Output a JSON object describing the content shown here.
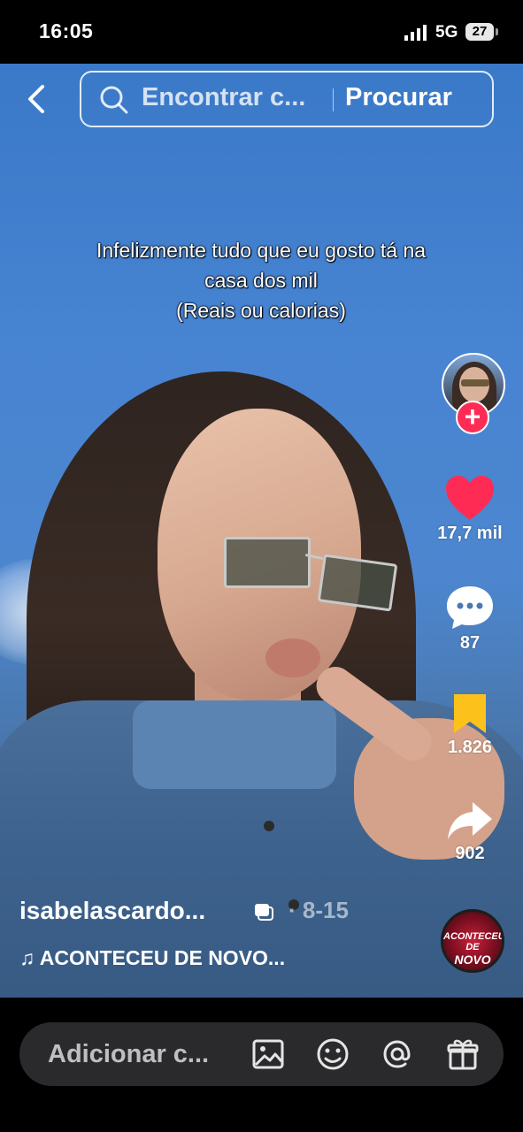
{
  "status_bar": {
    "time": "16:05",
    "network": "5G",
    "battery": "27"
  },
  "search": {
    "placeholder": "Encontrar c...",
    "button_label": "Procurar"
  },
  "caption": {
    "line1": "Infelizmente tudo que eu gosto tá na",
    "line2": "casa dos mil",
    "line3": "(Reais ou calorias)"
  },
  "actions": {
    "likes": "17,7 mil",
    "comments": "87",
    "saves": "1.826",
    "shares": "902"
  },
  "post": {
    "author": "isabelascardo...",
    "date": "· 8-15",
    "music": "♫ ACONTECEU DE NOVO..."
  },
  "music_disc": {
    "text_line1": "ACONTECEU DE",
    "text_line2": "NOVO"
  },
  "comment_bar": {
    "placeholder": "Adicionar c..."
  },
  "colors": {
    "like": "#fe2c55",
    "save": "#fcc21b",
    "follow": "#fe2c55"
  }
}
